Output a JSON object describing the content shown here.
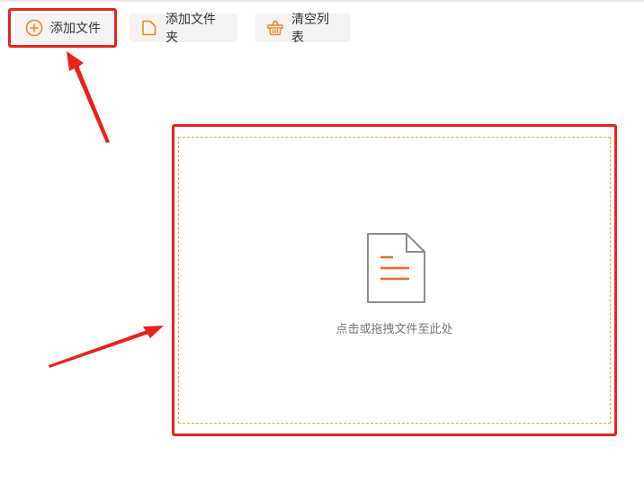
{
  "toolbar": {
    "add_file": {
      "label": "添加文件",
      "icon": "plus-circle-icon"
    },
    "add_folder": {
      "label": "添加文件夹",
      "icon": "folder-icon"
    },
    "clear_list": {
      "label": "清空列表",
      "icon": "basket-icon"
    }
  },
  "drop_zone": {
    "hint": "点击或拖拽文件至此处",
    "icon": "document-icon"
  },
  "colors": {
    "accent": "#f08a24",
    "highlight": "#e8231a",
    "dashed_border": "#e4a648"
  }
}
